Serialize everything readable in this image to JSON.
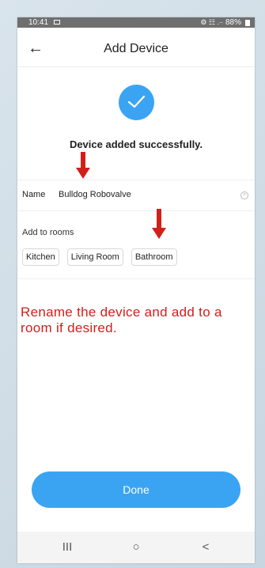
{
  "status_bar": {
    "time": "10:41",
    "icons_text": "⚙ ☷ .∙∙",
    "battery": "88%"
  },
  "header": {
    "back_icon": "←",
    "title": "Add Device"
  },
  "success": {
    "message": "Device added successfully."
  },
  "name_field": {
    "label": "Name",
    "value": "Bulldog Robovalve",
    "clear_icon": "×"
  },
  "rooms": {
    "label": "Add to rooms",
    "options": [
      "Kitchen",
      "Living Room",
      "Bathroom"
    ]
  },
  "instruction": "Rename the device and add to a room if desired.",
  "done_button": "Done",
  "nav": {
    "recents": "III",
    "home": "○",
    "back": "<"
  },
  "colors": {
    "accent": "#3aa4f3",
    "annotation": "#d1201a"
  }
}
